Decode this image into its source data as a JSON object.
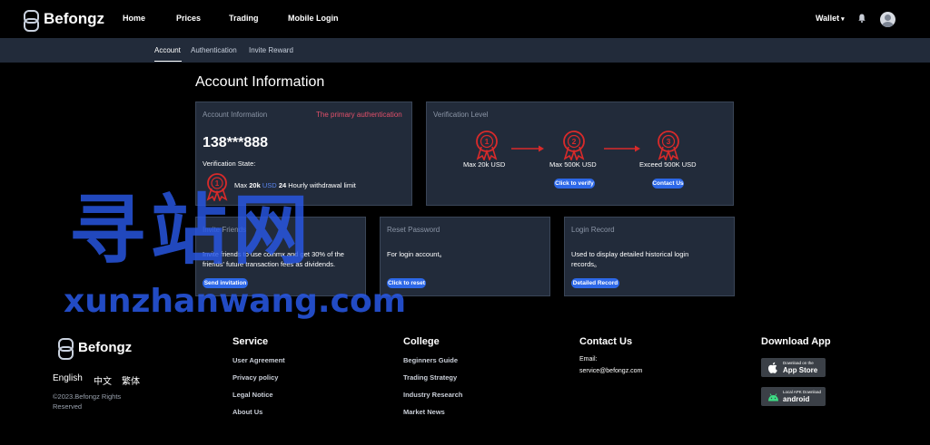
{
  "brand": "Befongz",
  "nav": {
    "items": [
      "Home",
      "Prices",
      "Trading",
      "Mobile Login"
    ],
    "wallet": "Wallet"
  },
  "subnav": [
    "Account",
    "Authentication",
    "Invite Reward"
  ],
  "page_title": "Account Information",
  "account_panel": {
    "label": "Account Information",
    "auth_link": "The primary authentication",
    "phone": "138***888",
    "state_label": "Verification State:",
    "limit_pre": "Max",
    "limit_amount": "20k",
    "limit_currency": "USD",
    "limit_hours": "24",
    "limit_post": "Hourly withdrawal limit"
  },
  "level_panel": {
    "label": "Verification Level",
    "levels": [
      {
        "num": "1",
        "text": "Max 20k USD"
      },
      {
        "num": "2",
        "text": "Max 500K USD",
        "button": "Click to verify"
      },
      {
        "num": "3",
        "text": "Exceed 500K USD",
        "button": "Contact Us"
      }
    ]
  },
  "invite_panel": {
    "label": "Invite Friends",
    "text_a": "Invite friends to use coinmx and get 30% of the",
    "text_b": "friends' future transaction fees as dividends.",
    "button": "Send invitation"
  },
  "reset_panel": {
    "label": "Reset Password",
    "text": "For login account。",
    "button": "Click to reset"
  },
  "record_panel": {
    "label": "Login Record",
    "text_a": "Used to display detailed historical login",
    "text_b": "records。",
    "button": "Detailed Record"
  },
  "watermark": {
    "cn": "寻站网",
    "en": "xunzhanwang.com"
  },
  "footer": {
    "languages": [
      "English",
      "中文",
      "繁体"
    ],
    "copyright": "©2023.Befongz Rights Reserved",
    "service": {
      "title": "Service",
      "links": [
        "User Agreement",
        "Privacy policy",
        "Legal Notice",
        "About Us"
      ]
    },
    "college": {
      "title": "College",
      "links": [
        "Beginners Guide",
        "Trading Strategy",
        "Industry Research",
        "Market News"
      ]
    },
    "contact": {
      "title": "Contact Us",
      "email_label": "Email:",
      "email": "service@befongz.com"
    },
    "download": {
      "title": "Download App",
      "appstore_small": "Download on the",
      "appstore_big": "App Store",
      "android_small": "Local APK Download",
      "android_big": "android"
    }
  },
  "colors": {
    "background": "#000000",
    "panel": "#222b3a",
    "accent_blue": "#2d68e8",
    "medal_red": "#d92a2a",
    "auth_pink": "#e2506a"
  }
}
